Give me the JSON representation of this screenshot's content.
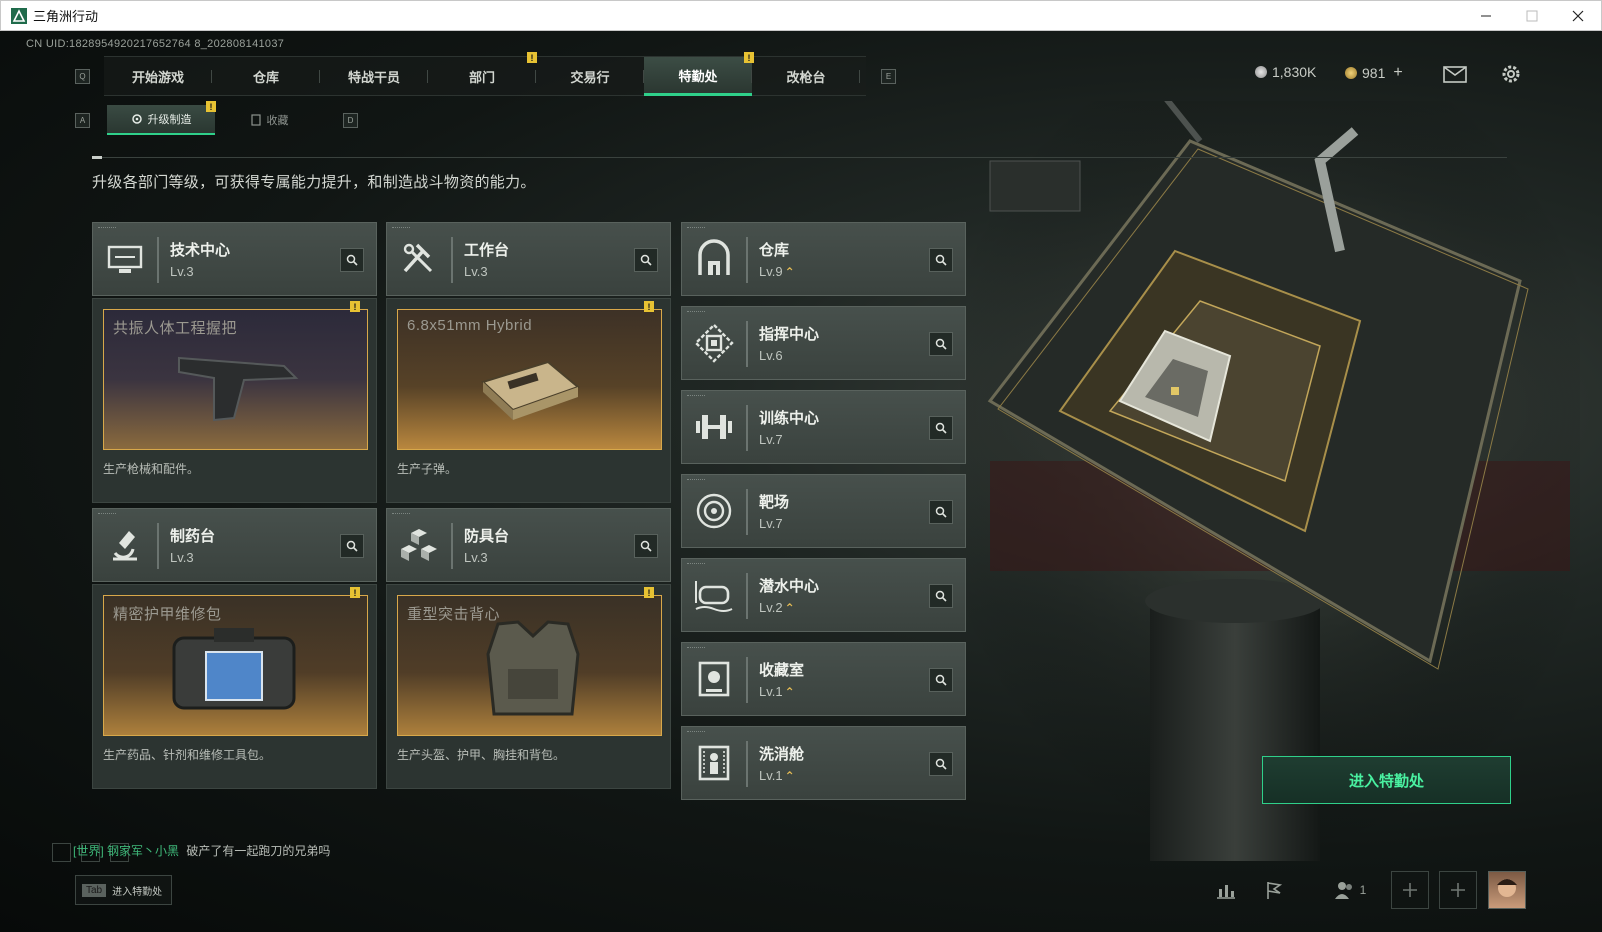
{
  "window": {
    "title": "三角洲行动"
  },
  "uid_text": "CN UID:1828954920217652764 8_202808141037",
  "nav": {
    "left_key": "Q",
    "right_key": "E",
    "tabs": [
      {
        "label": "开始游戏"
      },
      {
        "label": "仓库"
      },
      {
        "label": "特战干员"
      },
      {
        "label": "部门"
      },
      {
        "label": "交易行"
      },
      {
        "label": "特勤处"
      },
      {
        "label": "改枪台"
      }
    ],
    "active_tab": "特勤处",
    "notif_mark": "!"
  },
  "currency": {
    "coins": "1,830K",
    "tickets": "981",
    "plus": "+"
  },
  "subnav": {
    "left_key": "A",
    "right_key": "D",
    "tabs": [
      {
        "label": "升级制造"
      },
      {
        "label": "收藏"
      }
    ]
  },
  "description": "升级各部门等级，可获得专属能力提升，和制造战斗物资的能力。",
  "production_cards": [
    {
      "name": "技术中心",
      "level": "Lv.3",
      "product": "共振人体工程握把",
      "desc": "生产枪械和配件。"
    },
    {
      "name": "工作台",
      "level": "Lv.3",
      "product": "6.8x51mm Hybrid",
      "desc": "生产子弹。"
    },
    {
      "name": "制药台",
      "level": "Lv.3",
      "product": "精密护甲维修包",
      "desc": "生产药品、针剂和维修工具包。"
    },
    {
      "name": "防具台",
      "level": "Lv.3",
      "product": "重型突击背心",
      "desc": "生产头盔、护甲、胸挂和背包。"
    }
  ],
  "facilities": [
    {
      "name": "仓库",
      "level": "Lv.9",
      "upgradable": true
    },
    {
      "name": "指挥中心",
      "level": "Lv.6",
      "upgradable": false
    },
    {
      "name": "训练中心",
      "level": "Lv.7",
      "upgradable": false
    },
    {
      "name": "靶场",
      "level": "Lv.7",
      "upgradable": false
    },
    {
      "name": "潜水中心",
      "level": "Lv.2",
      "upgradable": true
    },
    {
      "name": "收藏室",
      "level": "Lv.1",
      "upgradable": true
    },
    {
      "name": "洗消舱",
      "level": "Lv.1",
      "upgradable": true
    }
  ],
  "upgrade_mark": "⌃",
  "enter_button": "进入特勤处",
  "chat": {
    "channel": "[世界]",
    "user": "钢家军丶小黑",
    "message": "破产了有一起跑刀的兄弟吗"
  },
  "tab_hint": {
    "key": "Tab",
    "label": "进入特勤处"
  },
  "squad_count": "1",
  "colors": {
    "accent": "#2fd08a",
    "gold": "#d8a84a",
    "notif": "#e7c233"
  }
}
